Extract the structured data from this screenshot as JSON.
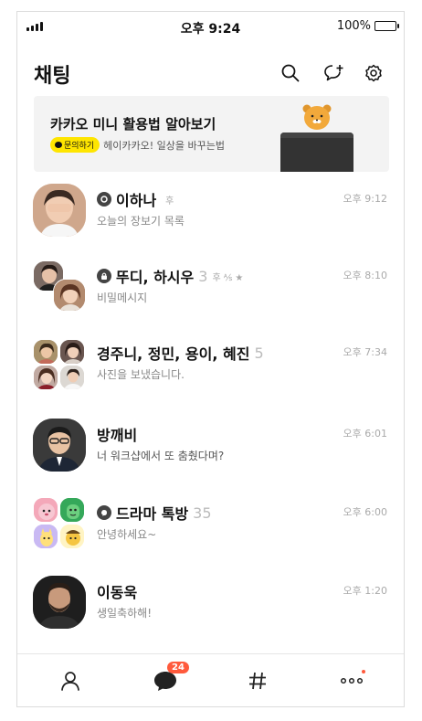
{
  "status_bar": {
    "time": "오후 9:24",
    "battery": "100%"
  },
  "header": {
    "title": "채팅"
  },
  "banner": {
    "title": "카카오 미니 활용법 알아보기",
    "tag": "문의하기",
    "subtitle": "헤이카카오! 일상을 바꾸는법"
  },
  "chats": [
    {
      "name": "이하나",
      "count": "",
      "meta": "후",
      "preview": "오늘의 장보기 목록",
      "time": "오후 9:12"
    },
    {
      "name": "뚜디, 하시우",
      "count": "3",
      "meta": "후 ⅍ ★",
      "preview": "비밀메시지",
      "time": "오후 8:10"
    },
    {
      "name": "경주니, 정민, 용이, 혜진",
      "count": "5",
      "meta": "",
      "preview": "사진을 보냈습니다.",
      "time": "오후 7:34"
    },
    {
      "name": "방깨비",
      "count": "",
      "meta": "",
      "preview": "너 워크샵에서 또 춤췄다며?",
      "time": "오후 6:01"
    },
    {
      "name": "드라마 톡방",
      "count": "35",
      "meta": "",
      "preview": "안녕하세요~",
      "time": "오후 6:00"
    },
    {
      "name": "이동욱",
      "count": "",
      "meta": "",
      "preview": "생일축하해!",
      "time": "오후 1:20"
    }
  ],
  "tabbar": {
    "chat_badge": "24"
  },
  "colors": {
    "accent_yellow": "#fee500",
    "badge_red": "#ff5a3c"
  }
}
